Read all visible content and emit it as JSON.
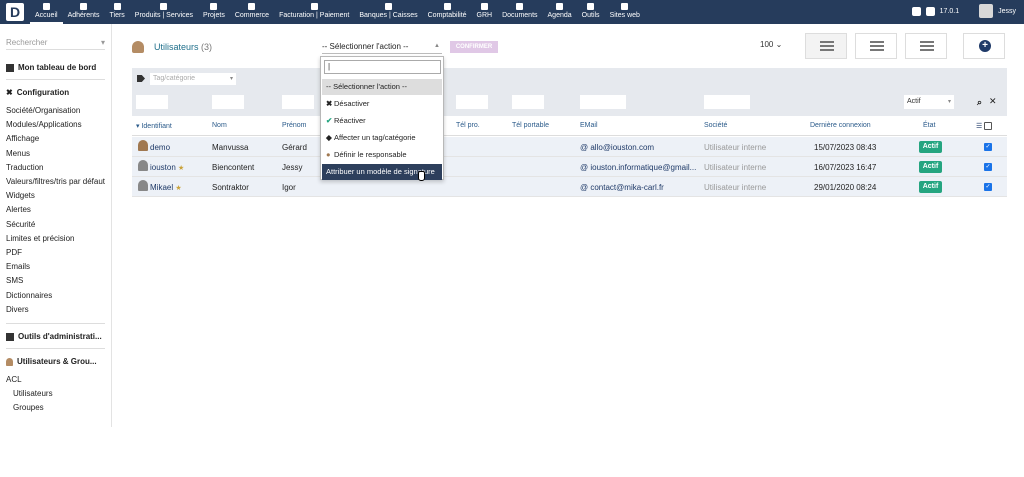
{
  "topbar": {
    "logo": "D",
    "menu": [
      {
        "label": "Accueil",
        "icon": "home-icon"
      },
      {
        "label": "Adhérents",
        "icon": "member-icon"
      },
      {
        "label": "Tiers",
        "icon": "building-icon"
      },
      {
        "label": "Produits | Services",
        "icon": "cube-icon"
      },
      {
        "label": "Projets",
        "icon": "project-icon"
      },
      {
        "label": "Commerce",
        "icon": "briefcase-icon"
      },
      {
        "label": "Facturation | Paiement",
        "icon": "invoice-icon"
      },
      {
        "label": "Banques | Caisses",
        "icon": "bank-icon"
      },
      {
        "label": "Comptabilité",
        "icon": "accounting-icon"
      },
      {
        "label": "GRH",
        "icon": "hr-icon"
      },
      {
        "label": "Documents",
        "icon": "folder-icon"
      },
      {
        "label": "Agenda",
        "icon": "calendar-icon"
      },
      {
        "label": "Outils",
        "icon": "wrench-icon"
      },
      {
        "label": "Sites web",
        "icon": "globe-icon"
      }
    ],
    "version": "17.0.1",
    "user": "Jessy"
  },
  "sidebar": {
    "search_placeholder": "Rechercher",
    "dashboard": "Mon tableau de bord",
    "configuration": "Configuration",
    "config_items": [
      "Société/Organisation",
      "Modules/Applications",
      "Affichage",
      "Menus",
      "Traduction",
      "Valeurs/filtres/tris par défaut",
      "Widgets",
      "Alertes",
      "Sécurité",
      "Limites et précision",
      "PDF",
      "Emails",
      "SMS",
      "Dictionnaires",
      "Divers"
    ],
    "admin_tools": "Outils d'administrati...",
    "users_groups": "Utilisateurs & Grou...",
    "users_items": [
      "ACL",
      "Utilisateurs",
      "Groupes"
    ]
  },
  "page": {
    "title": "Utilisateurs",
    "count": "(3)",
    "action_select": "-- Sélectionner l'action --",
    "confirm": "CONFIRMER",
    "limit": "100"
  },
  "filters": {
    "tag_placeholder": "Tag/catégorie",
    "status": "Actif"
  },
  "table": {
    "headers": {
      "login": "Identifiant",
      "lastname": "Nom",
      "firstname": "Prénom",
      "phone": "Tél pro.",
      "mobile": "Tél portable",
      "email": "EMail",
      "company": "Société",
      "last_login": "Dernière connexion",
      "status": "État"
    },
    "rows": [
      {
        "login": "demo",
        "lastname": "Manvussa",
        "firstname": "Gérard",
        "email": "allo@iouston.com",
        "company": "Utilisateur interne",
        "last_login": "15/07/2023 08:43",
        "status": "Actif"
      },
      {
        "login": "iouston",
        "lastname": "Biencontent",
        "firstname": "Jessy",
        "email": "iouston.informatique@gmail...",
        "company": "Utilisateur interne",
        "last_login": "16/07/2023 16:47",
        "status": "Actif"
      },
      {
        "login": "Mikael",
        "lastname": "Sontraktor",
        "firstname": "Igor",
        "email": "contact@mika-carl.fr",
        "company": "Utilisateur interne",
        "last_login": "29/01/2020 08:24",
        "status": "Actif"
      }
    ]
  },
  "dropdown": {
    "search_value": "|",
    "items": [
      {
        "label": "-- Sélectionner l'action --",
        "icon": ""
      },
      {
        "label": "Désactiver",
        "icon": "x-icon"
      },
      {
        "label": "Réactiver",
        "icon": "check-icon"
      },
      {
        "label": "Affecter un tag/catégorie",
        "icon": "tag-icon"
      },
      {
        "label": "Définir le responsable",
        "icon": "user-icon"
      },
      {
        "label": "Attribuer un modèle de signature",
        "icon": ""
      }
    ]
  },
  "colors": {
    "topbar": "#263c5c",
    "badge": "#25a580",
    "accent": "#1f6f8b"
  }
}
